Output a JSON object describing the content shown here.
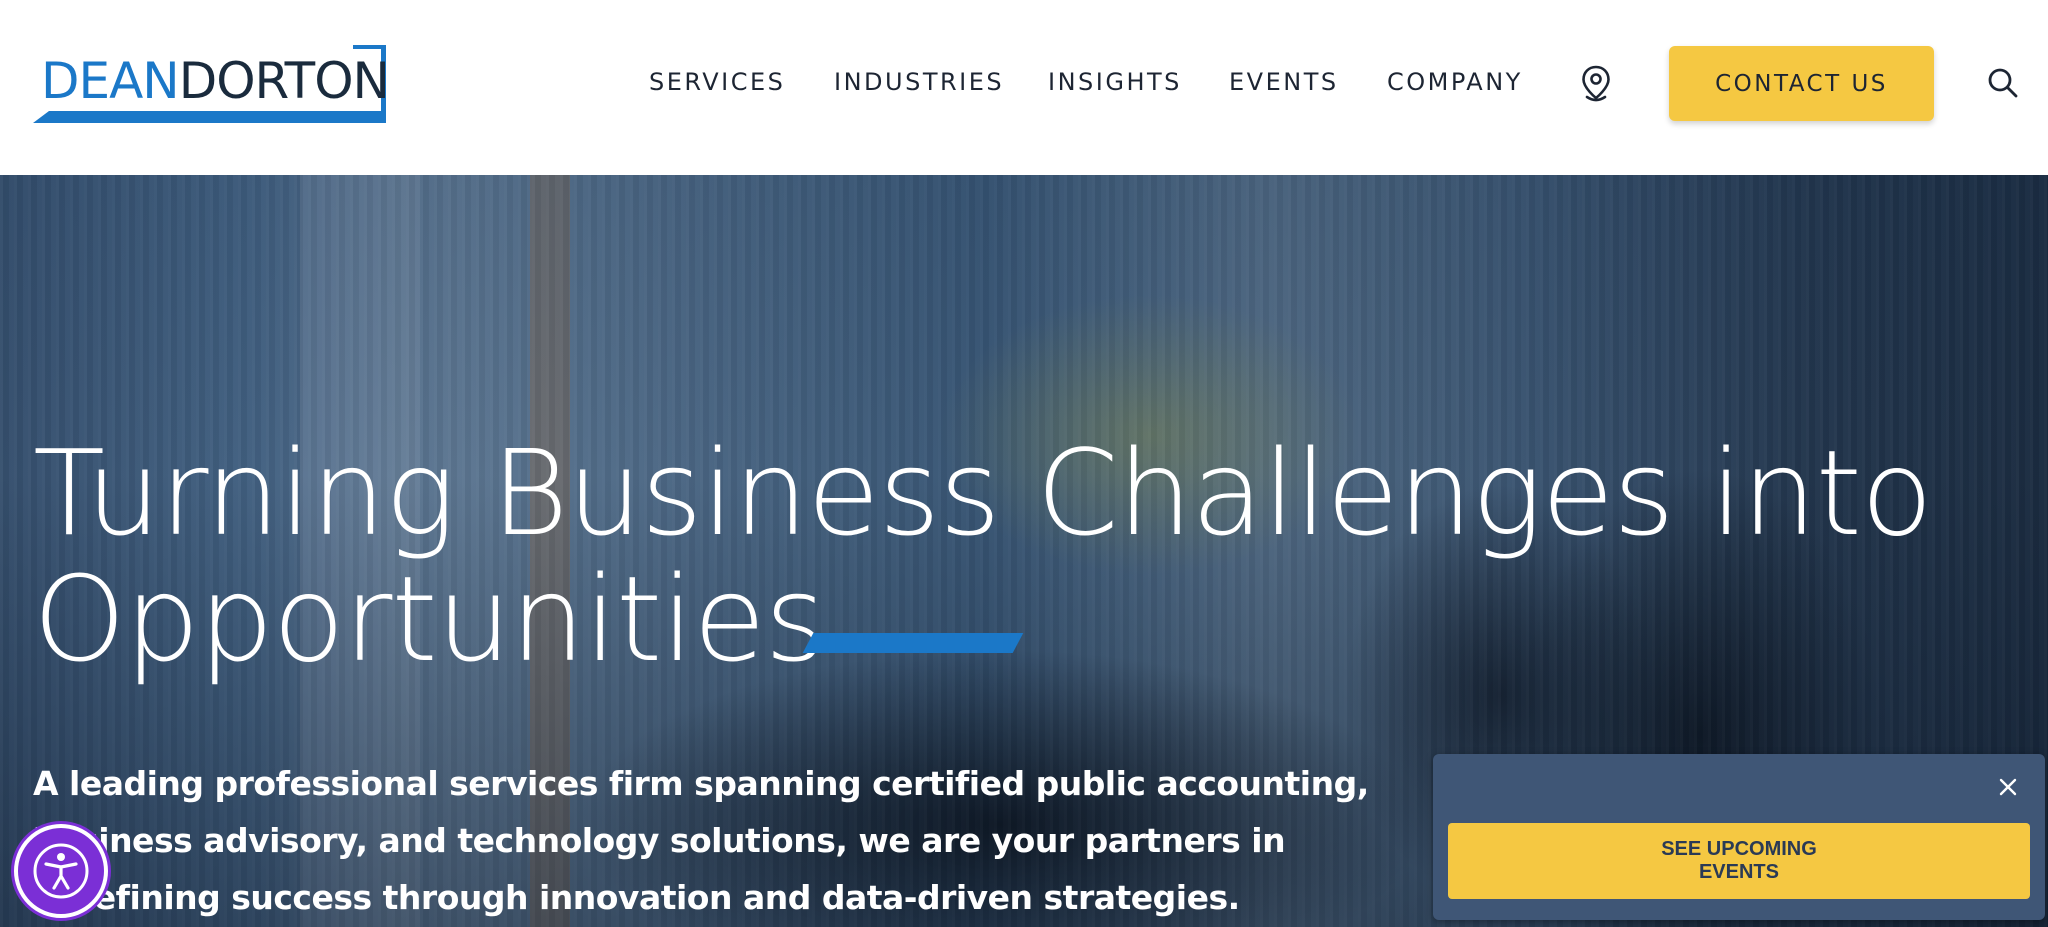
{
  "header": {
    "logo": {
      "part1": "DEAN",
      "part2": "DORTON"
    },
    "nav": [
      {
        "label": "SERVICES"
      },
      {
        "label": "INDUSTRIES"
      },
      {
        "label": "INSIGHTS"
      },
      {
        "label": "EVENTS"
      },
      {
        "label": "COMPANY"
      }
    ],
    "location_icon": "map-pin-icon",
    "contact_label": "CONTACT US",
    "search_icon": "search-icon"
  },
  "hero": {
    "title_line1": "Turning Business Challenges into",
    "title_line2": "Opportunities",
    "description": "A leading professional services firm spanning certified public accounting, business advisory, and technology solutions, we are your partners in redefining success through innovation and data-driven strategies."
  },
  "popup": {
    "button_label": "SEE UPCOMING\nEVENTS",
    "close_icon": "close-icon"
  },
  "accessibility": {
    "icon": "accessibility-icon"
  },
  "colors": {
    "brand_blue": "#1b78c8",
    "accent_yellow": "#f5c842",
    "dark_text": "#1d2533",
    "popup_bg": "#3f5676",
    "a11y_purple": "#7b2fd6"
  }
}
